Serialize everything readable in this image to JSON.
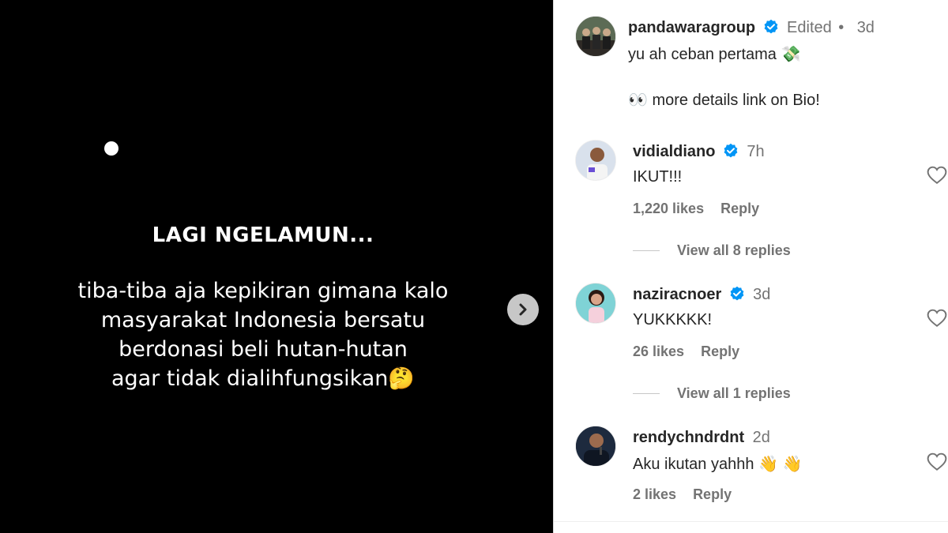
{
  "post": {
    "title": "LAGI NGELAMUN...",
    "lines": [
      "tiba-tiba aja kepikiran gimana kalo",
      "masyarakat Indonesia bersatu",
      "berdonasi beli hutan-hutan",
      "agar tidak dialihfungsikan🤔"
    ]
  },
  "caption": {
    "username": "pandawaragroup",
    "edited": "Edited",
    "separator": "•",
    "time": "3d",
    "line1": "yu ah ceban pertama 💸",
    "line2": "👀 more details link on Bio!"
  },
  "comments": [
    {
      "username": "vidialdiano",
      "time": "7h",
      "text": "IKUT!!!",
      "likes": "1,220 likes",
      "reply": "Reply",
      "view_replies": "View all 8 replies"
    },
    {
      "username": "naziracnoer",
      "time": "3d",
      "text": "YUKKKKK!",
      "likes": "26 likes",
      "reply": "Reply",
      "view_replies": "View all 1 replies"
    },
    {
      "username": "rendychndrdnt",
      "time": "2d",
      "text": "Aku ikutan yahhh 👋 👋",
      "likes": "2 likes",
      "reply": "Reply"
    }
  ],
  "colors": {
    "verified": "#0095f6",
    "muted": "#737373",
    "text": "#262626"
  }
}
